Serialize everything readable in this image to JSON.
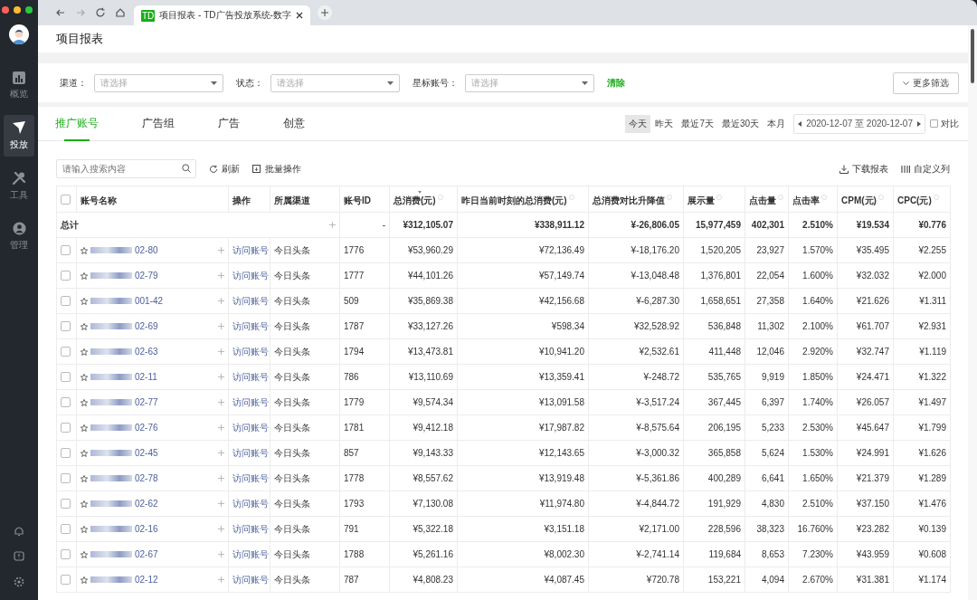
{
  "browser": {
    "favicon": "TD",
    "tab_title": "项目报表 - TD广告投放系统-数字"
  },
  "sidebar": {
    "items": [
      {
        "label": "概览",
        "selected": false
      },
      {
        "label": "投放",
        "selected": true
      },
      {
        "label": "工具",
        "selected": false
      },
      {
        "label": "管理",
        "selected": false
      }
    ]
  },
  "page_title": "项目报表",
  "filters": [
    {
      "label": "渠道：",
      "placeholder": "请选择"
    },
    {
      "label": "状态：",
      "placeholder": "请选择"
    },
    {
      "label": "星标账号：",
      "placeholder": "请选择"
    }
  ],
  "clear": "清除",
  "more_filters": "更多筛选",
  "tabs": [
    {
      "label": "推广账号",
      "selected": true
    },
    {
      "label": "广告组",
      "selected": false
    },
    {
      "label": "广告",
      "selected": false
    },
    {
      "label": "创意",
      "selected": false
    }
  ],
  "date_presets": [
    {
      "label": "今天",
      "selected": true
    },
    {
      "label": "昨天",
      "selected": false
    },
    {
      "label": "最近7天",
      "selected": false
    },
    {
      "label": "最近30天",
      "selected": false
    },
    {
      "label": "本月",
      "selected": false
    }
  ],
  "date_range": "2020-12-07 至 2020-12-07",
  "compare": {
    "label": "对比",
    "checked": false
  },
  "search": {
    "placeholder": "请输入搜索内容"
  },
  "actions": [
    {
      "label": "刷新"
    },
    {
      "label": "批量操作"
    }
  ],
  "right_actions": [
    {
      "label": "下载报表"
    },
    {
      "label": "自定义列"
    }
  ],
  "table": {
    "all_checked": false,
    "columns": [
      {
        "label": "账号名称",
        "help": false,
        "sorted": false
      },
      {
        "label": "操作",
        "help": false,
        "sorted": false
      },
      {
        "label": "所属渠道",
        "help": false,
        "sorted": false
      },
      {
        "label": "账号ID",
        "help": false,
        "sorted": false
      },
      {
        "label": "总消费(元)",
        "help": true,
        "sorted": true
      },
      {
        "label": "昨日当前时刻的总消费(元)",
        "help": true,
        "sorted": false
      },
      {
        "label": "总消费对比升降值",
        "help": true,
        "sorted": false
      },
      {
        "label": "展示量",
        "help": true,
        "sorted": false
      },
      {
        "label": "点击量",
        "help": true,
        "sorted": false
      },
      {
        "label": "点击率",
        "help": true,
        "sorted": false
      },
      {
        "label": "CPM(元)",
        "help": true,
        "sorted": false
      },
      {
        "label": "CPC(元)",
        "help": true,
        "sorted": false
      }
    ],
    "total": {
      "label": "总计",
      "id": "-",
      "values": [
        "¥312,105.07",
        "¥338,911.12",
        "¥-26,806.05",
        "15,977,459",
        "402,301",
        "2.510%",
        "¥19.534",
        "¥0.776"
      ]
    },
    "rows": [
      {
        "checked": false,
        "name": "02-80",
        "action": "访问账号",
        "channel": "今日头条",
        "id": "1776",
        "values": [
          "¥53,960.29",
          "¥72,136.49",
          "¥-18,176.20",
          "1,520,205",
          "23,927",
          "1.570%",
          "¥35.495",
          "¥2.255"
        ]
      },
      {
        "checked": false,
        "name": "02-79",
        "action": "访问账号",
        "channel": "今日头条",
        "id": "1777",
        "values": [
          "¥44,101.26",
          "¥57,149.74",
          "¥-13,048.48",
          "1,376,801",
          "22,054",
          "1.600%",
          "¥32.032",
          "¥2.000"
        ]
      },
      {
        "checked": false,
        "name": "001-42",
        "action": "访问账号",
        "channel": "今日头条",
        "id": "509",
        "values": [
          "¥35,869.38",
          "¥42,156.68",
          "¥-6,287.30",
          "1,658,651",
          "27,358",
          "1.640%",
          "¥21.626",
          "¥1.311"
        ]
      },
      {
        "checked": false,
        "name": "02-69",
        "action": "访问账号",
        "channel": "今日头条",
        "id": "1787",
        "values": [
          "¥33,127.26",
          "¥598.34",
          "¥32,528.92",
          "536,848",
          "11,302",
          "2.100%",
          "¥61.707",
          "¥2.931"
        ]
      },
      {
        "checked": false,
        "name": "02-63",
        "action": "访问账号",
        "channel": "今日头条",
        "id": "1794",
        "values": [
          "¥13,473.81",
          "¥10,941.20",
          "¥2,532.61",
          "411,448",
          "12,046",
          "2.920%",
          "¥32.747",
          "¥1.119"
        ]
      },
      {
        "checked": false,
        "name": "02-11",
        "action": "访问账号",
        "channel": "今日头条",
        "id": "786",
        "values": [
          "¥13,110.69",
          "¥13,359.41",
          "¥-248.72",
          "535,765",
          "9,919",
          "1.850%",
          "¥24.471",
          "¥1.322"
        ]
      },
      {
        "checked": false,
        "name": "02-77",
        "action": "访问账号",
        "channel": "今日头条",
        "id": "1779",
        "values": [
          "¥9,574.34",
          "¥13,091.58",
          "¥-3,517.24",
          "367,445",
          "6,397",
          "1.740%",
          "¥26.057",
          "¥1.497"
        ]
      },
      {
        "checked": false,
        "name": "02-76",
        "action": "访问账号",
        "channel": "今日头条",
        "id": "1781",
        "values": [
          "¥9,412.18",
          "¥17,987.82",
          "¥-8,575.64",
          "206,195",
          "5,233",
          "2.530%",
          "¥45.647",
          "¥1.799"
        ]
      },
      {
        "checked": false,
        "name": "02-45",
        "action": "访问账号",
        "channel": "今日头条",
        "id": "857",
        "values": [
          "¥9,143.33",
          "¥12,143.65",
          "¥-3,000.32",
          "365,858",
          "5,624",
          "1.530%",
          "¥24.991",
          "¥1.626"
        ]
      },
      {
        "checked": false,
        "name": "02-78",
        "action": "访问账号",
        "channel": "今日头条",
        "id": "1778",
        "values": [
          "¥8,557.62",
          "¥13,919.48",
          "¥-5,361.86",
          "400,289",
          "6,641",
          "1.650%",
          "¥21.379",
          "¥1.289"
        ]
      },
      {
        "checked": false,
        "name": "02-62",
        "action": "访问账号",
        "channel": "今日头条",
        "id": "1793",
        "values": [
          "¥7,130.08",
          "¥11,974.80",
          "¥-4,844.72",
          "191,929",
          "4,830",
          "2.510%",
          "¥37.150",
          "¥1.476"
        ]
      },
      {
        "checked": false,
        "name": "02-16",
        "action": "访问账号",
        "channel": "今日头条",
        "id": "791",
        "values": [
          "¥5,322.18",
          "¥3,151.18",
          "¥2,171.00",
          "228,596",
          "38,323",
          "16.760%",
          "¥23.282",
          "¥0.139"
        ]
      },
      {
        "checked": false,
        "name": "02-67",
        "action": "访问账号",
        "channel": "今日头条",
        "id": "1788",
        "values": [
          "¥5,261.16",
          "¥8,002.30",
          "¥-2,741.14",
          "119,684",
          "8,653",
          "7.230%",
          "¥43.959",
          "¥0.608"
        ]
      },
      {
        "checked": false,
        "name": "02-12",
        "action": "访问账号",
        "channel": "今日头条",
        "id": "787",
        "values": [
          "¥4,808.23",
          "¥4,087.45",
          "¥720.78",
          "153,221",
          "4,094",
          "2.670%",
          "¥31.381",
          "¥1.174"
        ]
      }
    ]
  }
}
